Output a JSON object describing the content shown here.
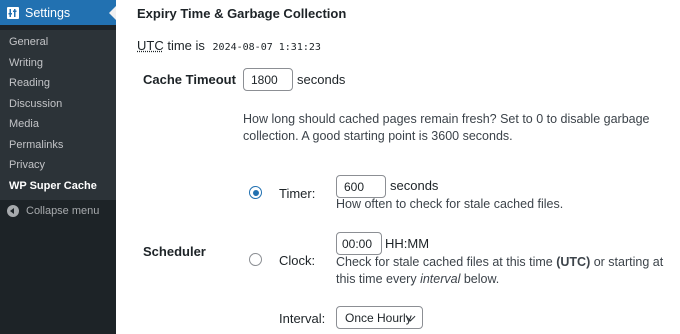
{
  "sidebar": {
    "header_label": "Settings",
    "header_icon": "settings-icon",
    "items": [
      {
        "label": "General"
      },
      {
        "label": "Writing"
      },
      {
        "label": "Reading"
      },
      {
        "label": "Discussion"
      },
      {
        "label": "Media"
      },
      {
        "label": "Permalinks"
      },
      {
        "label": "Privacy"
      },
      {
        "label": "WP Super Cache",
        "active": true
      }
    ],
    "collapse_label": "Collapse menu"
  },
  "section": {
    "title": "Expiry Time & Garbage Collection",
    "utc_abbr": "UTC",
    "utc_text": "time is",
    "utc_time": "2024-08-07 1:31:23"
  },
  "cache_timeout": {
    "label": "Cache Timeout",
    "value": "1800",
    "unit": "seconds",
    "description": "How long should cached pages remain fresh? Set to 0 to disable garbage collection. A good starting point is 3600 seconds."
  },
  "scheduler": {
    "label": "Scheduler",
    "timer": {
      "label": "Timer:",
      "selected": true,
      "value": "600",
      "unit": "seconds",
      "description": "How often to check for stale cached files."
    },
    "clock": {
      "label": "Clock:",
      "selected": false,
      "value": "00:00",
      "format": "HH:MM",
      "desc_before": "Check for stale cached files at this time ",
      "desc_bold": "(UTC)",
      "desc_middle": " or starting at this time every ",
      "desc_italic": "interval",
      "desc_after": " below."
    },
    "interval": {
      "label": "Interval:",
      "selected_option": "Once Hourly"
    }
  },
  "colors": {
    "accent": "#2271b1",
    "sidebar_bg": "#1d2327",
    "submenu_bg": "#2c3338"
  }
}
